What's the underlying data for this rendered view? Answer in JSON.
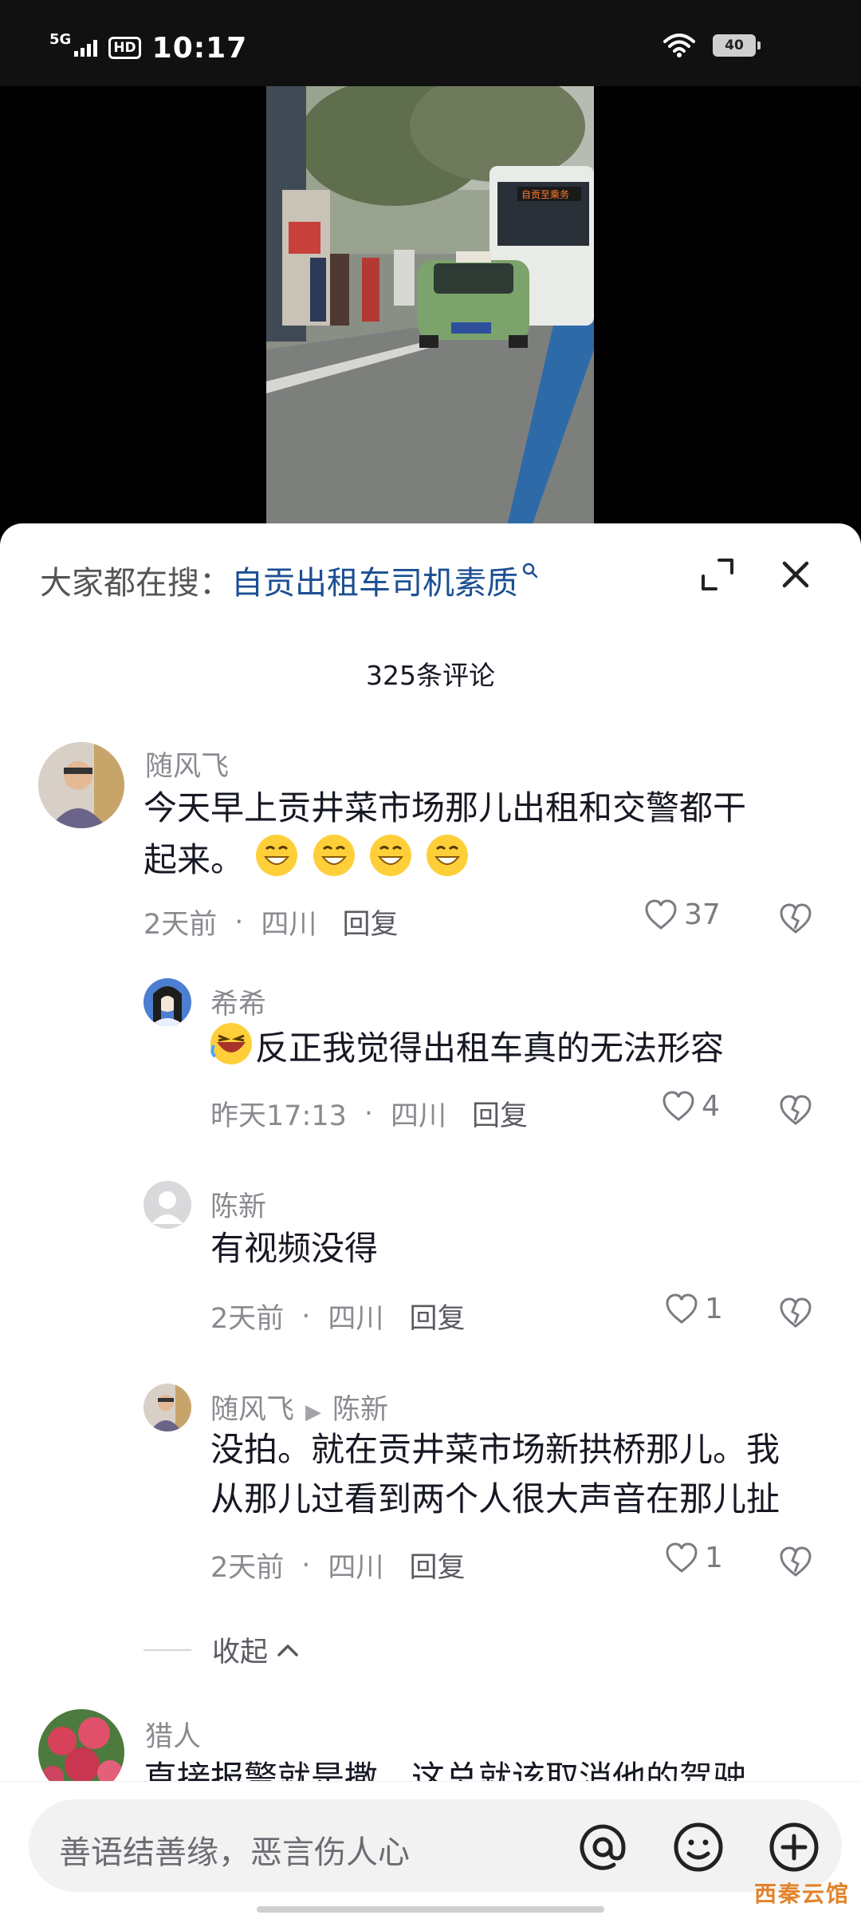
{
  "status_bar": {
    "network": "5G",
    "hd": "HD",
    "time": "10:17",
    "battery": "40"
  },
  "sheet": {
    "search_prefix": "大家都在搜：",
    "search_query": "自贡出租车司机素质",
    "comment_count": "325条评论"
  },
  "comments": [
    {
      "name": "随风飞",
      "text_line1": "今天早上贡井菜市场那儿出租和交警都干",
      "text_line2": "起来。",
      "time": "2天前",
      "location": "四川",
      "reply": "回复",
      "likes": "37"
    },
    {
      "name": "希希",
      "text": "反正我觉得出租车真的无法形容",
      "time": "昨天17:13",
      "location": "四川",
      "reply": "回复",
      "likes": "4"
    },
    {
      "name": "陈新",
      "text": "有视频没得",
      "time": "2天前",
      "location": "四川",
      "reply": "回复",
      "likes": "1"
    },
    {
      "name": "随风飞",
      "reply_to": "陈新",
      "text_line1": "没拍。就在贡井菜市场新拱桥那儿。我",
      "text_line2": "从那儿过看到两个人很大声音在那儿扯",
      "time": "2天前",
      "location": "四川",
      "reply": "回复",
      "likes": "1"
    },
    {
      "name": "猎人",
      "text_partial": "直接报警就是撒，这总就该取消他的驾驶"
    }
  ],
  "collapse_label": "收起",
  "input": {
    "placeholder": "善语结善缘，恶言伤人心"
  },
  "watermark": "西秦云馆",
  "icons": [
    "expand-icon",
    "close-icon",
    "heart-icon",
    "dislike-heart-icon",
    "at-icon",
    "emoji-icon",
    "plus-icon"
  ]
}
